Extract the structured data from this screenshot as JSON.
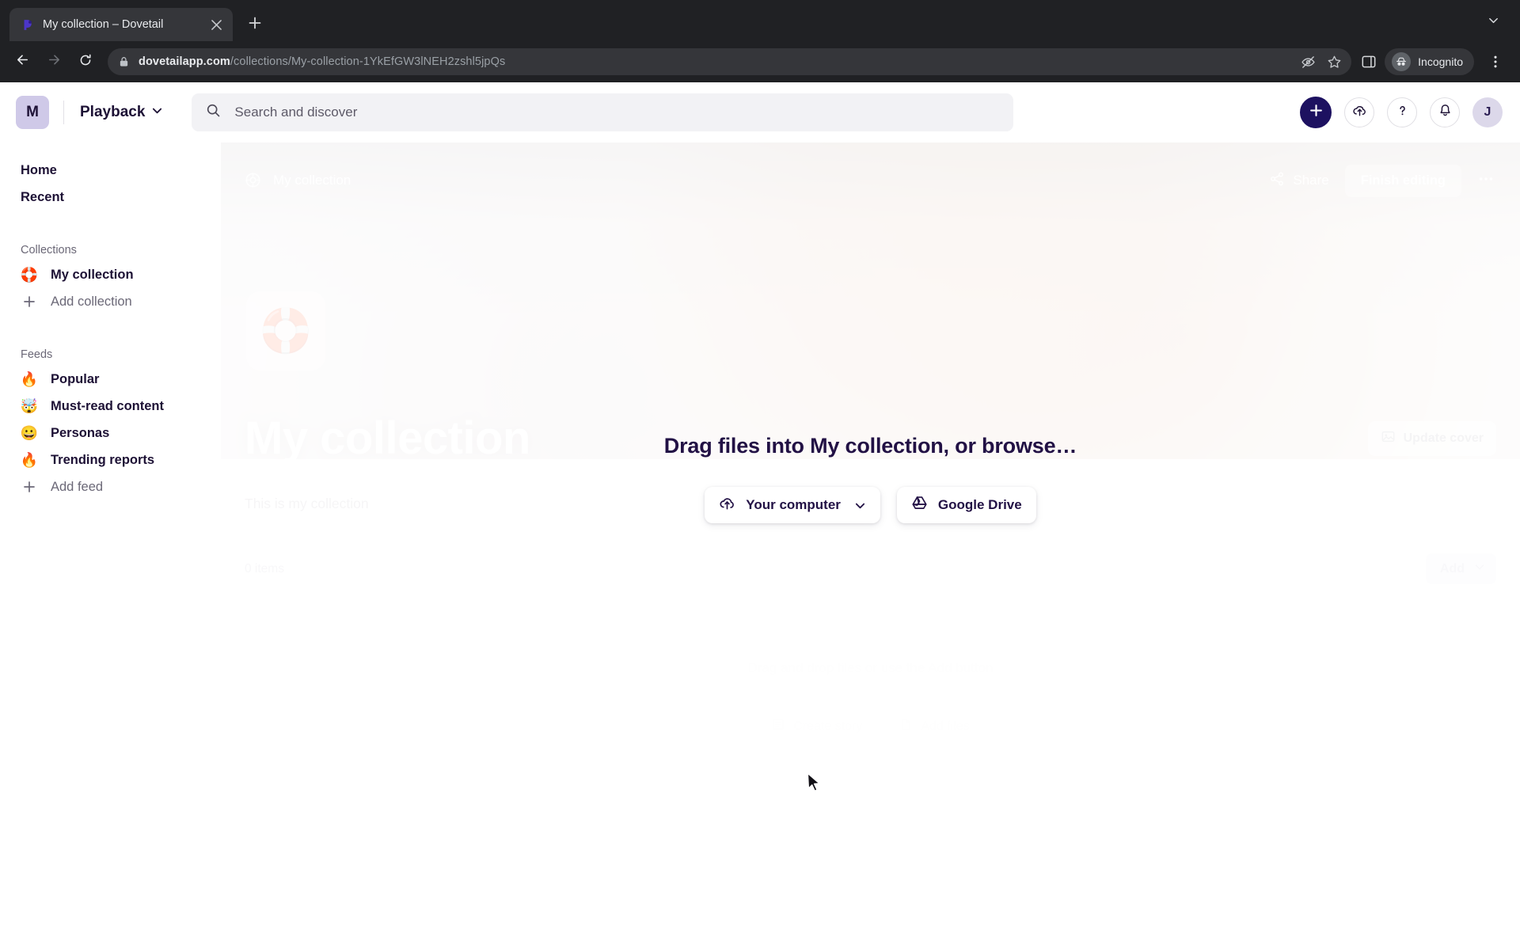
{
  "browser": {
    "tab": {
      "title": "My collection – Dovetail",
      "favicon_icon": "dovetail-logo-icon",
      "close_icon": "close-icon"
    },
    "new_tab_icon": "plus-icon",
    "tabstrip_chevron_icon": "chevron-down-icon",
    "back_icon": "back-arrow-icon",
    "forward_icon": "forward-arrow-icon",
    "reload_icon": "reload-icon",
    "lock_icon": "lock-icon",
    "url": {
      "host": "dovetailapp.com",
      "path": "/collections/My-collection-1YkEfGW3lNEH2zshl5jpQs"
    },
    "url_actions": {
      "tracking_icon": "eye-off-icon",
      "bookmark_icon": "star-icon"
    },
    "side_panel_icon": "side-panel-icon",
    "incognito": {
      "label": "Incognito",
      "icon": "incognito-icon"
    },
    "menu_icon": "kebab-menu-icon"
  },
  "topbar": {
    "workspace_initial": "M",
    "project_name": "Playback",
    "project_chevron_icon": "chevron-down-icon",
    "search": {
      "placeholder": "Search and discover",
      "icon": "search-icon"
    },
    "actions": [
      {
        "name": "create-button",
        "icon": "plus-icon"
      },
      {
        "name": "upload-button",
        "icon": "cloud-upload-icon"
      },
      {
        "name": "help-button",
        "icon": "question-mark-icon"
      },
      {
        "name": "notifications-button",
        "icon": "bell-icon"
      }
    ],
    "avatar_initial": "J"
  },
  "sidebar": {
    "primary": [
      {
        "label": "Home"
      },
      {
        "label": "Recent"
      }
    ],
    "collections_header": "Collections",
    "collections": [
      {
        "label": "My collection",
        "emoji": "🛟"
      }
    ],
    "add_collection": {
      "label": "Add collection",
      "icon": "plus-icon"
    },
    "feeds_header": "Feeds",
    "feeds": [
      {
        "label": "Popular",
        "emoji": "🔥"
      },
      {
        "label": "Must-read content",
        "emoji": "🤯"
      },
      {
        "label": "Personas",
        "emoji": "😀"
      },
      {
        "label": "Trending reports",
        "emoji": "🔥"
      }
    ],
    "add_feed": {
      "label": "Add feed",
      "icon": "plus-icon"
    }
  },
  "hero": {
    "breadcrumb_label": "My collection",
    "breadcrumb_icon": "collection-icon",
    "share_label": "Share",
    "share_icon": "share-icon",
    "finish_editing_label": "Finish editing",
    "more_icon": "ellipsis-icon",
    "collection_emoji": "🛟",
    "title": "My collection",
    "update_cover_label": "Update cover",
    "update_cover_icon": "image-icon"
  },
  "content": {
    "description": "This is my collection",
    "item_count": "0 items",
    "add_label": "Add",
    "add_chevron_icon": "chevron-down-icon",
    "empty_hint": "Drag and drop files or use the Add button",
    "empty_actions": [
      {
        "label": "Create story",
        "icon": "story-icon"
      },
      {
        "label": "Add files",
        "icon": "file-icon"
      }
    ]
  },
  "drop_overlay": {
    "title": "Drag files into My collection, or browse…",
    "buttons": [
      {
        "label": "Your computer",
        "icon": "cloud-upload-icon",
        "chevron_icon": "chevron-down-icon"
      },
      {
        "label": "Google Drive",
        "icon": "google-drive-icon"
      }
    ]
  },
  "cursor": {
    "icon": "mouse-pointer-icon"
  },
  "colors": {
    "brand_dark": "#1d1160",
    "text_dark": "#221145",
    "muted": "#6b6877",
    "chrome_bg": "#202124",
    "chrome_tab": "#35363a",
    "search_bg": "#f2f2f5"
  }
}
